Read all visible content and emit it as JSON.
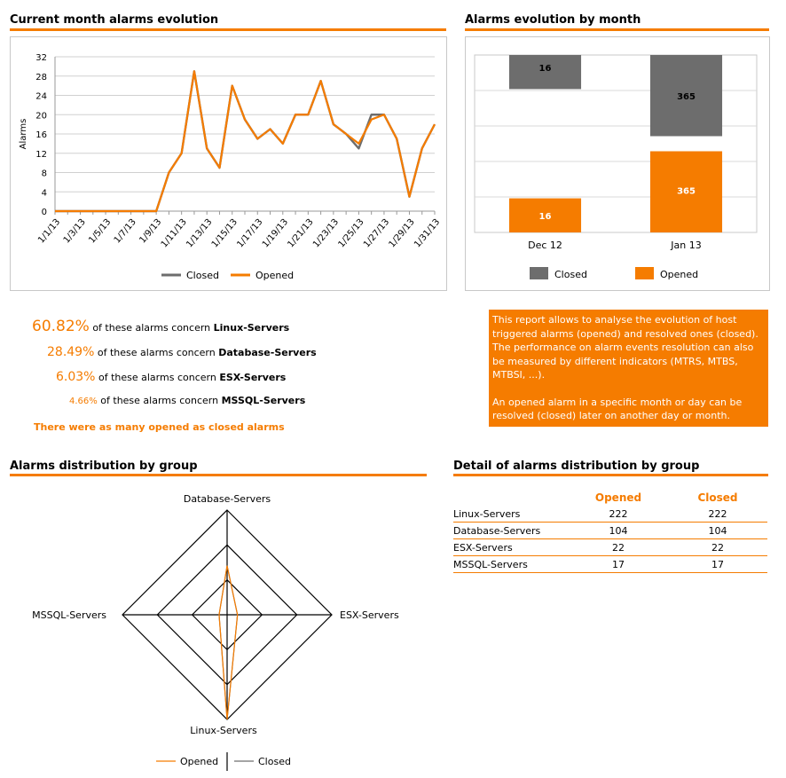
{
  "sections": {
    "current_month": "Current month alarms evolution",
    "by_month": "Alarms evolution by month",
    "distribution": "Alarms distribution by group",
    "detail": "Detail of alarms distribution by group"
  },
  "colors": {
    "accent": "#f57c00",
    "closed": "#6d6d6d",
    "opened": "#f57c00"
  },
  "stats": [
    {
      "pct": "60.82%",
      "text": "of these alarms concern",
      "group": "Linux-Servers"
    },
    {
      "pct": "28.49%",
      "text": "of these alarms concern",
      "group": "Database-Servers"
    },
    {
      "pct": "6.03%",
      "text": "of these alarms concern",
      "group": "ESX-Servers"
    },
    {
      "pct": "4.66%",
      "text": "of these alarms concern",
      "group": "MSSQL-Servers"
    }
  ],
  "summary": "There were as many opened as closed alarms",
  "info": {
    "p1": "This report allows to analyse the evolution of host triggered alarms (opened) and resolved ones (closed). The performance on alarm events resolution can also be measured by different indicators (MTRS, MTBS, MTBSI, ...).",
    "p2": "An opened alarm in a specific month or day can be resolved (closed) later on another day or month."
  },
  "table": {
    "headers": [
      "",
      "Opened",
      "Closed"
    ],
    "rows": [
      [
        "Linux-Servers",
        "222",
        "222"
      ],
      [
        "Database-Servers",
        "104",
        "104"
      ],
      [
        "ESX-Servers",
        "22",
        "22"
      ],
      [
        "MSSQL-Servers",
        "17",
        "17"
      ]
    ]
  },
  "chart_data": [
    {
      "type": "line",
      "ylabel": "Alarms",
      "ylim": [
        0,
        32
      ],
      "yticks": [
        0,
        4,
        8,
        12,
        16,
        20,
        24,
        28,
        32
      ],
      "x": [
        "1/1/13",
        "1/2/13",
        "1/3/13",
        "1/4/13",
        "1/5/13",
        "1/6/13",
        "1/7/13",
        "1/8/13",
        "1/9/13",
        "1/10/13",
        "1/11/13",
        "1/12/13",
        "1/13/13",
        "1/14/13",
        "1/15/13",
        "1/16/13",
        "1/17/13",
        "1/18/13",
        "1/19/13",
        "1/20/13",
        "1/21/13",
        "1/22/13",
        "1/23/13",
        "1/24/13",
        "1/25/13",
        "1/26/13",
        "1/27/13",
        "1/28/13",
        "1/29/13",
        "1/30/13",
        "1/31/13"
      ],
      "xtick_labels": [
        "1/1/13",
        "1/3/13",
        "1/5/13",
        "1/7/13",
        "1/9/13",
        "1/11/13",
        "1/13/13",
        "1/15/13",
        "1/17/13",
        "1/19/13",
        "1/21/13",
        "1/23/13",
        "1/25/13",
        "1/27/13",
        "1/29/13",
        "1/31/13"
      ],
      "series": [
        {
          "name": "Closed",
          "color": "#6d6d6d",
          "values": [
            0,
            0,
            0,
            0,
            0,
            0,
            0,
            0,
            0,
            8,
            12,
            29,
            13,
            9,
            26,
            19,
            15,
            17,
            14,
            20,
            20,
            27,
            18,
            16,
            13,
            20,
            20,
            15,
            3,
            13,
            18
          ]
        },
        {
          "name": "Opened",
          "color": "#f57c00",
          "values": [
            0,
            0,
            0,
            0,
            0,
            0,
            0,
            0,
            0,
            8,
            12,
            29,
            13,
            9,
            26,
            19,
            15,
            17,
            14,
            20,
            20,
            27,
            18,
            16,
            14,
            19,
            20,
            15,
            3,
            13,
            18
          ]
        }
      ],
      "legend": "bottom",
      "grid": true
    },
    {
      "type": "bar",
      "categories": [
        "Dec 12",
        "Jan 13"
      ],
      "series": [
        {
          "name": "Closed",
          "color": "#6d6d6d",
          "values": [
            16,
            365
          ]
        },
        {
          "name": "Opened",
          "color": "#f57c00",
          "values": [
            16,
            365
          ]
        }
      ],
      "legend": "bottom",
      "grid": true
    },
    {
      "type": "radar",
      "axes": [
        "Database-Servers",
        "ESX-Servers",
        "Linux-Servers",
        "MSSQL-Servers"
      ],
      "series": [
        {
          "name": "Opened",
          "color": "#f57c00",
          "values": [
            104,
            22,
            222,
            17
          ]
        },
        {
          "name": "Closed",
          "color": "#6d6d6d",
          "values": [
            104,
            22,
            222,
            17
          ]
        }
      ],
      "legend": "bottom"
    }
  ]
}
